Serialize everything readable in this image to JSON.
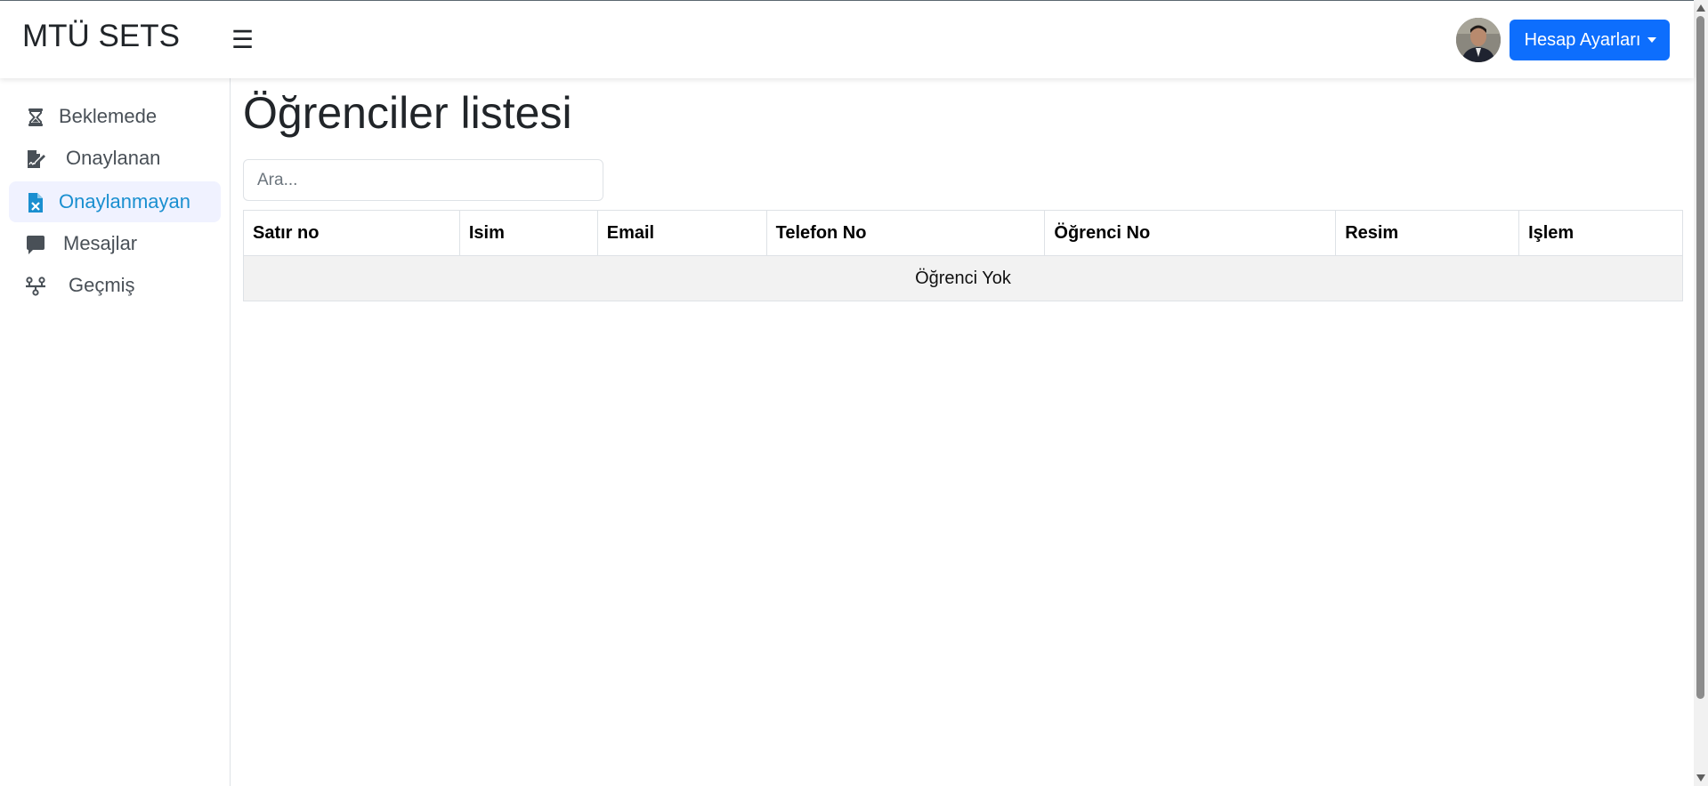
{
  "app": {
    "title": "MTÜ SETS"
  },
  "header": {
    "menu_icon": "☰",
    "avatar_icon": "user-avatar",
    "account_label": "Hesap Ayarları",
    "accent_color": "#0d6efd"
  },
  "sidebar": {
    "active_color": "#1a8fd0",
    "items": [
      {
        "label": "Beklemede",
        "icon": "hourglass-icon"
      },
      {
        "label": "Onaylanan",
        "icon": "file-signature-icon"
      },
      {
        "label": "Onaylanmayan",
        "icon": "file-excel-icon",
        "active": true
      },
      {
        "label": "Mesajlar",
        "icon": "message-icon"
      },
      {
        "label": "Geçmiş",
        "icon": "timeline-icon"
      }
    ]
  },
  "main": {
    "title": "Öğrenciler listesi",
    "search_placeholder": "Ara...",
    "table": {
      "columns": [
        "Satır no",
        "Isim",
        "Email",
        "Telefon No",
        "Öğrenci No",
        "Resim",
        "Işlem"
      ],
      "empty_message": "Öğrenci Yok"
    }
  }
}
